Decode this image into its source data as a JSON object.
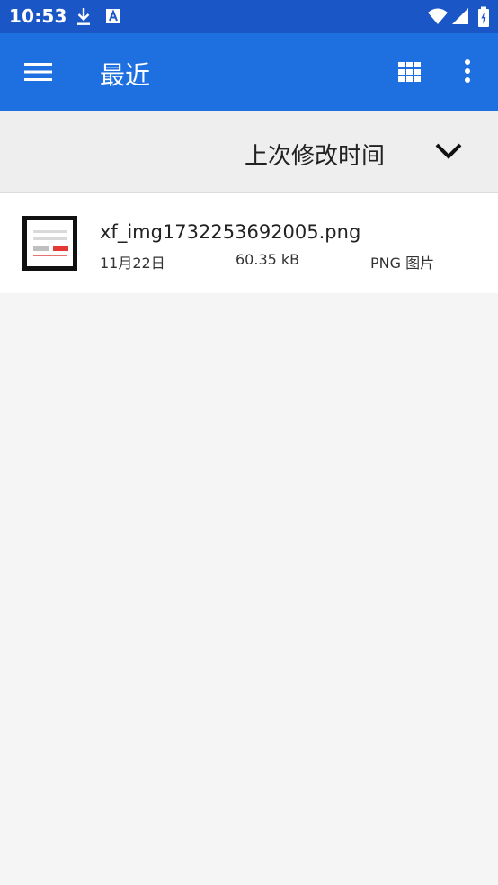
{
  "status_bar": {
    "time": "10:53",
    "icons": [
      "download-icon",
      "a-notification-icon",
      "wifi-icon",
      "signal-icon",
      "battery-icon"
    ]
  },
  "app_bar": {
    "title": "最近",
    "icons": [
      "menu-icon",
      "grid-view-icon",
      "more-vert-icon"
    ]
  },
  "sort": {
    "label": "上次修改时间",
    "icon": "chevron-down-icon"
  },
  "files": [
    {
      "name": "xf_img1732253692005.png",
      "date": "11月22日",
      "size": "60.35 kB",
      "type": "PNG 图片"
    }
  ],
  "colors": {
    "status_bar": "#1b56c7",
    "app_bar": "#1e6fe0",
    "sort_bar": "#eeeeee",
    "background": "#f5f5f5"
  }
}
